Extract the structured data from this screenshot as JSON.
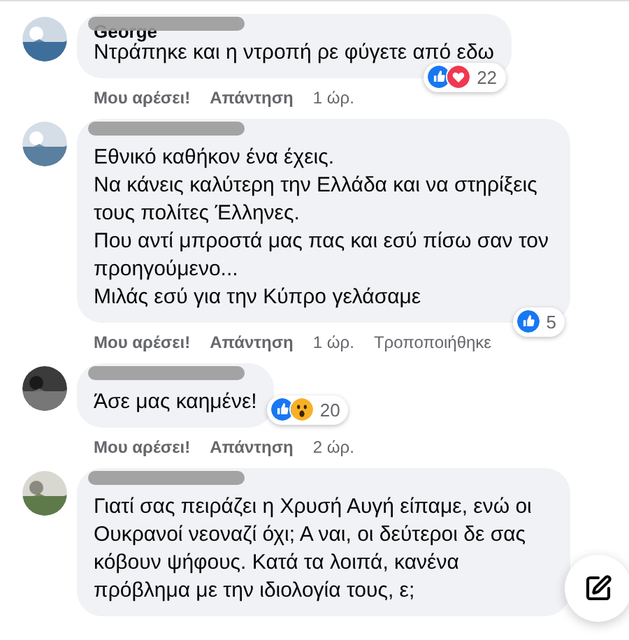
{
  "comments": [
    {
      "author": "George",
      "body": [
        "Ντράπηκε και η ντροπή ρε φύγετε από εδω"
      ],
      "reactions": {
        "items": [
          {
            "kind": "like"
          },
          {
            "kind": "love"
          }
        ],
        "count": "22"
      },
      "actions": {
        "like": "Μου αρέσει!",
        "reply": "Απάντηση",
        "time": "1 ώρ."
      }
    },
    {
      "body": [
        "Εθνικό καθήκον ένα έχεις.",
        "Να κάνεις καλύτερη την Ελλάδα και να στηρίξεις τους πολίτες Έλληνες.",
        "Που αντί μπροστά μας πας και εσύ πίσω σαν τον προηγούμενο...",
        "Μιλάς εσύ για την Κύπρο γελάσαμε"
      ],
      "reactions": {
        "items": [
          {
            "kind": "like"
          }
        ],
        "count": "5"
      },
      "actions": {
        "like": "Μου αρέσει!",
        "reply": "Απάντηση",
        "time": "1 ώρ.",
        "edited": "Τροποποιήθηκε"
      }
    },
    {
      "body": [
        "Άσε μας καημένε!"
      ],
      "reactions": {
        "items": [
          {
            "kind": "like"
          },
          {
            "kind": "wow"
          }
        ],
        "count": "20"
      },
      "actions": {
        "like": "Μου αρέσει!",
        "reply": "Απάντηση",
        "time": "2 ώρ."
      }
    },
    {
      "body": [
        "Γιατί σας πειράζει η Χρυσή Αυγή είπαμε, ενώ οι Ουκρανοί νεοναζί όχι; Α ναι, οι δεύτεροι δε σας κόβουν ψήφους. Κατά τα λοιπά, κανένα πρόβλημα με την ιδιολογία τους, ε;"
      ]
    }
  ]
}
